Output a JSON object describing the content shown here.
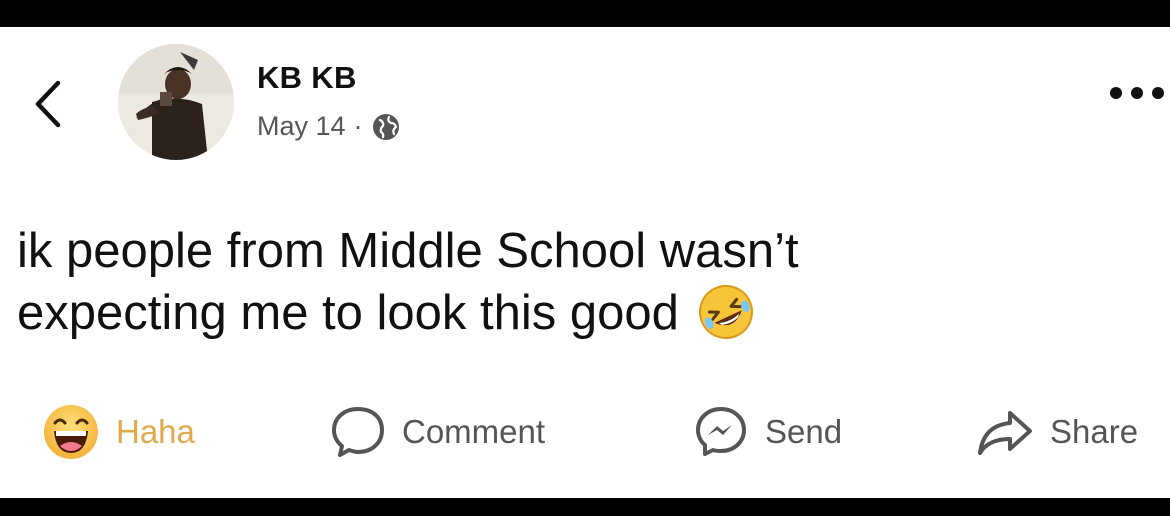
{
  "post": {
    "author": "KB KB",
    "date": "May 14",
    "separator": "·",
    "text_line1": "ik people from Middle School wasn’t",
    "text_line2": "expecting me to look this good"
  },
  "icons": {
    "back": "chevron-left-icon",
    "privacy": "globe-icon",
    "more": "more-horizontal-icon",
    "post_emoji": "rolling-on-floor-laughing-emoji"
  },
  "actions": {
    "haha": "Haha",
    "comment": "Comment",
    "send": "Send",
    "share": "Share"
  },
  "colors": {
    "haha_text": "#e0a94a",
    "text": "#111111",
    "muted": "#555555",
    "background": "#ffffff"
  }
}
